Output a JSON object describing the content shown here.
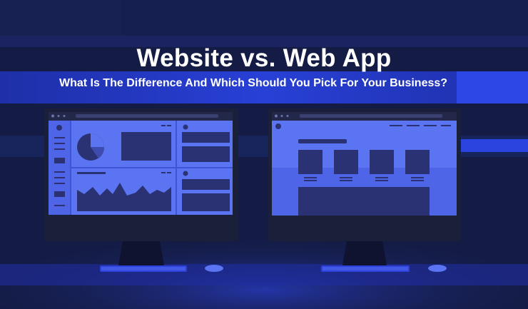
{
  "header": {
    "title": "Website vs. Web App",
    "subtitle": "What Is The Difference And Which Should You Pick For Your Business?"
  },
  "illustrations": {
    "left": "web-app-dashboard-monitor",
    "right": "website-monitor"
  },
  "colors": {
    "background": "#141c45",
    "accent": "#2e41d8",
    "screen": "#5a74f2",
    "screen_elements": "#2a3273"
  }
}
